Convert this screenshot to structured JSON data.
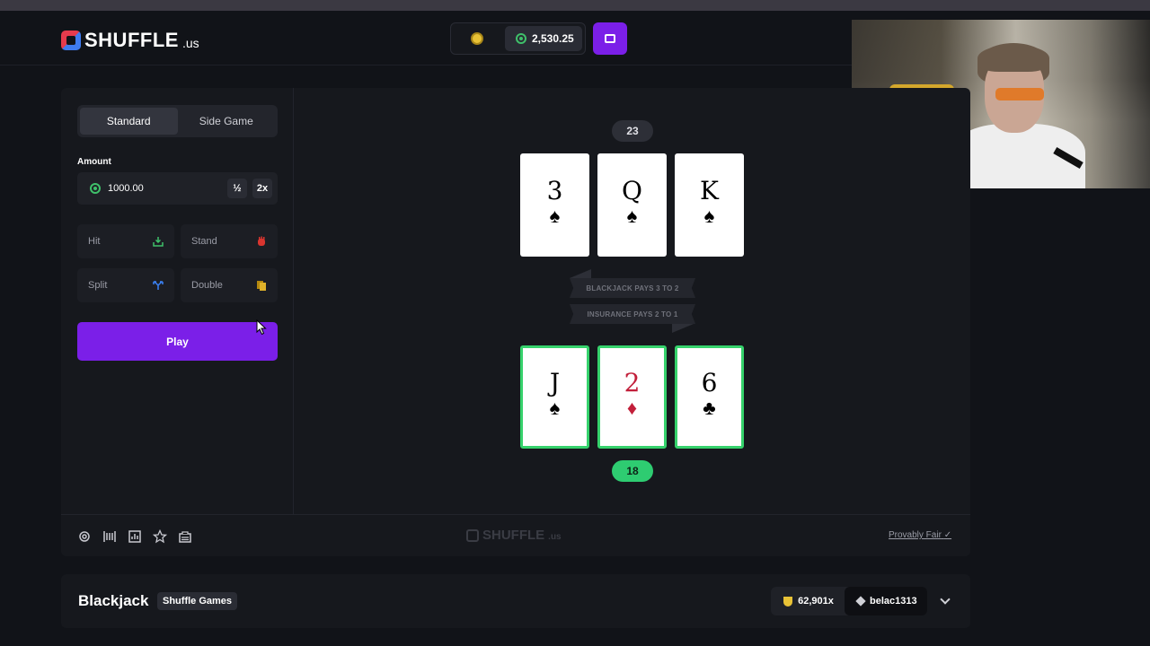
{
  "header": {
    "logo_text": "SHUFFLE",
    "logo_suffix": ".us",
    "balance": "2,530.25"
  },
  "mode_tabs": [
    "Standard",
    "Side Game"
  ],
  "bet": {
    "amount_label": "Amount",
    "amount_value": "1000.00",
    "half_label": "½",
    "double_label": "2x"
  },
  "actions": {
    "hit": "Hit",
    "stand": "Stand",
    "split": "Split",
    "double": "Double"
  },
  "play_label": "Play",
  "dealer": {
    "score": "23",
    "cards": [
      {
        "rank": "3",
        "suit": "♠"
      },
      {
        "rank": "Q",
        "suit": "♠"
      },
      {
        "rank": "K",
        "suit": "♠"
      }
    ]
  },
  "player": {
    "score": "18",
    "cards": [
      {
        "rank": "J",
        "suit": "♠"
      },
      {
        "rank": "2",
        "suit": "♦"
      },
      {
        "rank": "6",
        "suit": "♣"
      }
    ]
  },
  "banners": {
    "blackjack": "BLACKJACK PAYS 3 TO 2",
    "insurance": "INSURANCE PAYS 2 TO 1"
  },
  "footer": {
    "logo_text": "SHUFFLE",
    "logo_suffix": ".us",
    "provably_fair": "Provably Fair"
  },
  "info": {
    "title": "Blackjack",
    "provider": "Shuffle Games",
    "multiplier": "62,901x",
    "username": "belac1313"
  },
  "colors": {
    "accent": "#7b1fe8",
    "win_green": "#2ecc71",
    "red_suit": "#c21f3a"
  }
}
